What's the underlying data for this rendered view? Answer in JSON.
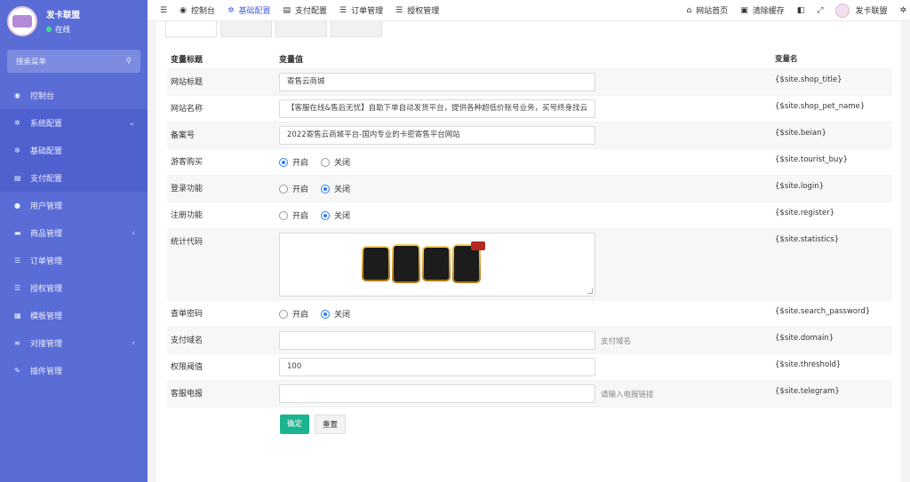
{
  "sidebar": {
    "name": "发卡联盟",
    "status": "在线",
    "search_placeholder": "搜索菜单",
    "items": [
      {
        "label": "控制台",
        "icon": "dashboard-icon",
        "glyph": "◉"
      },
      {
        "label": "系统配置",
        "icon": "gear-icon",
        "glyph": "✲",
        "arrow": "⌄"
      },
      {
        "label": "基础配置",
        "icon": "gear-icon",
        "glyph": "✲"
      },
      {
        "label": "支付配置",
        "icon": "list-icon",
        "glyph": "▤"
      },
      {
        "label": "用户管理",
        "icon": "user-icon",
        "glyph": "●"
      },
      {
        "label": "商品管理",
        "icon": "cart-icon",
        "glyph": "▬",
        "arrow": "‹"
      },
      {
        "label": "订单管理",
        "icon": "menu-icon",
        "glyph": "☰"
      },
      {
        "label": "授权管理",
        "icon": "menu-icon",
        "glyph": "☰"
      },
      {
        "label": "模板管理",
        "icon": "table-icon",
        "glyph": "▦"
      },
      {
        "label": "对接管理",
        "icon": "sliders-icon",
        "glyph": "≡",
        "arrow": "‹"
      },
      {
        "label": "插件管理",
        "icon": "plug-icon",
        "glyph": "✎"
      }
    ]
  },
  "topbar": {
    "menu_glyph": "☰",
    "tabs": [
      {
        "label": "控制台",
        "glyph": "◉"
      },
      {
        "label": "基础配置",
        "glyph": "✲"
      },
      {
        "label": "支付配置",
        "glyph": "▤"
      },
      {
        "label": "订单管理",
        "glyph": "☰"
      },
      {
        "label": "授权管理",
        "glyph": "☰"
      }
    ],
    "home_label": "网站首页",
    "clear_cache_label": "清除缓存",
    "user_name": "发卡联盟"
  },
  "table": {
    "headers": [
      "变量标题",
      "变量值",
      "变量名"
    ],
    "rows": {
      "shop_title": {
        "label": "网站标题",
        "value": "寄售云商城",
        "var": "{$site.shop_title}"
      },
      "shop_pet_name": {
        "label": "网站名称",
        "value": "【客服在线&售后无忧】自助下单自动发货平台，提供各种超低价账号业务，买号终身找云",
        "var": "{$site.shop_pet_name}"
      },
      "beian": {
        "label": "备案号",
        "value": "2022寄售云商城平台-国内专业的卡密寄售平台网站",
        "var": "{$site.beian}"
      },
      "tourist_buy": {
        "label": "游客购买",
        "on": "开启",
        "off": "关闭",
        "var": "{$site.tourist_buy}"
      },
      "login": {
        "label": "登录功能",
        "on": "开启",
        "off": "关闭",
        "var": "{$site.login}"
      },
      "register": {
        "label": "注册功能",
        "on": "开启",
        "off": "关闭",
        "var": "{$site.register}"
      },
      "statistics": {
        "label": "统计代码",
        "var": "{$site.statistics}"
      },
      "search_password": {
        "label": "查单密码",
        "on": "开启",
        "off": "关闭",
        "var": "{$site.search_password}"
      },
      "domain": {
        "label": "支付域名",
        "value": "",
        "hint": "支付域名",
        "var": "{$site.domain}"
      },
      "threshold": {
        "label": "权限阈值",
        "value": "100",
        "var": "{$site.threshold}"
      },
      "telegram": {
        "label": "客服电报",
        "value": "",
        "hint": "请输入电报链接",
        "var": "{$site.telegram}"
      }
    }
  },
  "buttons": {
    "confirm": "确定",
    "reset": "重置"
  },
  "colors": {
    "sidebar": "#5a6cd6",
    "primary": "#1cb48e",
    "accent": "#4b62d8"
  }
}
